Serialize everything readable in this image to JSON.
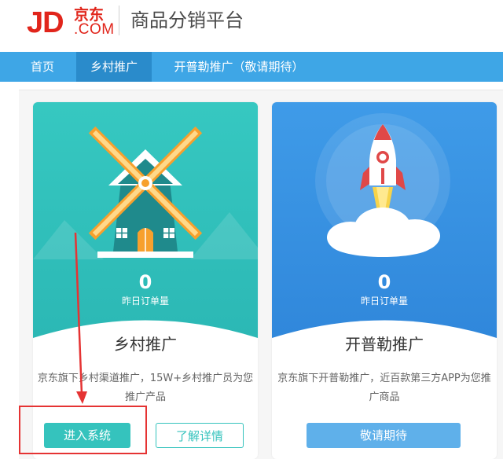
{
  "header": {
    "logo_jd": "JD",
    "logo_cn": "京东",
    "logo_com": ".COM",
    "platform_title": "商品分销平台"
  },
  "nav": {
    "items": [
      {
        "label": "首页"
      },
      {
        "label": "乡村推广"
      },
      {
        "label": "开普勒推广（敬请期待）"
      }
    ]
  },
  "cards": [
    {
      "count": "0",
      "count_label": "昨日订单量",
      "name": "乡村推广",
      "description": "京东旗下乡村渠道推广，15W+乡村推广员为您推广产品",
      "buttons": [
        "进入系统",
        "了解详情"
      ],
      "illustration": "windmill-icon"
    },
    {
      "count": "0",
      "count_label": "昨日订单量",
      "name": "开普勒推广",
      "description": "京东旗下开普勒推广，近百款第三方APP为您推广商品",
      "buttons": [
        "敬请期待"
      ],
      "illustration": "rocket-icon"
    }
  ],
  "colors": {
    "brand_red": "#e1251b",
    "nav_blue": "#3ea6e6",
    "nav_active": "#2a8bcb",
    "teal": "#35c3bd",
    "blue": "#3f9be8",
    "annotation_red": "#e53333"
  }
}
